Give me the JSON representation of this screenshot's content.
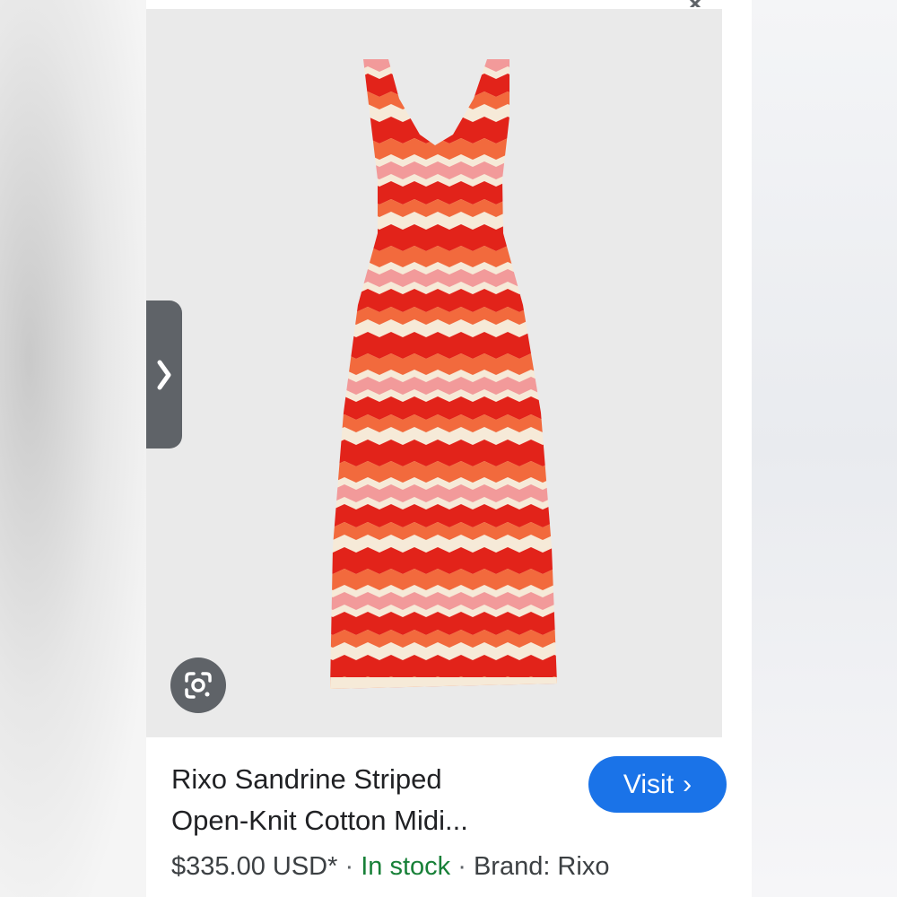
{
  "product": {
    "title_line1": "Rixo Sandrine Striped",
    "title_line2": "Open-Knit Cotton Midi...",
    "price": "$335.00 USD*",
    "separator": "·",
    "availability": "In stock",
    "brand": "Brand: Rixo"
  },
  "actions": {
    "visit_label": "Visit",
    "visit_chevron": "›",
    "nav_chevron": "›"
  },
  "icons": {
    "close": "close-icon",
    "lens": "google-lens-icon",
    "nav": "chevron-right-icon"
  },
  "colors": {
    "accent": "#1a73e8",
    "stock": "#188038",
    "stripe_red": "#e2231a",
    "stripe_orange": "#f26a3d",
    "stripe_pink": "#f29a9a",
    "stripe_cream": "#f6ead8"
  }
}
